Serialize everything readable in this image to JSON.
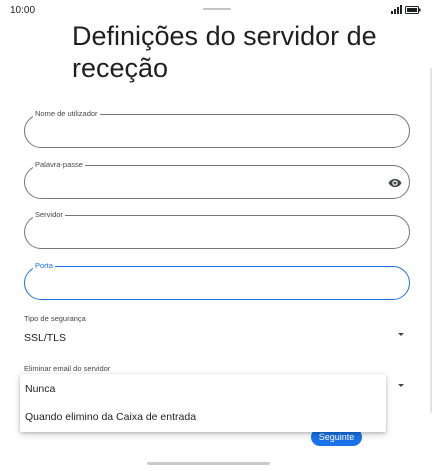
{
  "status_bar": {
    "time": "10:00"
  },
  "page": {
    "title": "Definições do servidor de receção"
  },
  "fields": {
    "username": {
      "label": "Nome de utilizador",
      "value": ""
    },
    "password": {
      "label": "Palavra-passe",
      "value": "",
      "icon": "eye-icon"
    },
    "server": {
      "label": "Servidor",
      "value": ""
    },
    "port": {
      "label": "Porta",
      "value": "",
      "focused": true
    }
  },
  "security": {
    "label": "Tipo de segurança",
    "value": "SSL/TLS"
  },
  "delete_email": {
    "label": "Eliminar email do servidor",
    "options": [
      "Nunca",
      "Quando elimino da Caixa de entrada"
    ]
  },
  "actions": {
    "next_label": "Seguinte"
  },
  "colors": {
    "accent": "#1a73e8",
    "outline": "#747775"
  }
}
